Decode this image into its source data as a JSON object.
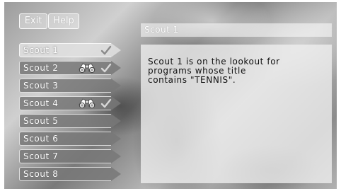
{
  "toolbar": {
    "exit_label": "Exit",
    "help_label": "Help"
  },
  "detail": {
    "title": "Scout 1",
    "description_lines": [
      "Scout 1 is on the lookout for",
      "programs whose title",
      "contains \"TENNIS\"."
    ]
  },
  "scouts": [
    {
      "label": "Scout 1",
      "selected": true,
      "binoculars": false,
      "check": true
    },
    {
      "label": "Scout 2",
      "selected": false,
      "binoculars": true,
      "check": true
    },
    {
      "label": "Scout 3",
      "selected": false,
      "binoculars": false,
      "check": false
    },
    {
      "label": "Scout 4",
      "selected": false,
      "binoculars": true,
      "check": true
    },
    {
      "label": "Scout 5",
      "selected": false,
      "binoculars": false,
      "check": false
    },
    {
      "label": "Scout 6",
      "selected": false,
      "binoculars": false,
      "check": false
    },
    {
      "label": "Scout 7",
      "selected": false,
      "binoculars": false,
      "check": false
    },
    {
      "label": "Scout 8",
      "selected": false,
      "binoculars": false,
      "check": false
    }
  ],
  "icons": {
    "active": "binoculars-icon",
    "enabled": "check-icon"
  }
}
